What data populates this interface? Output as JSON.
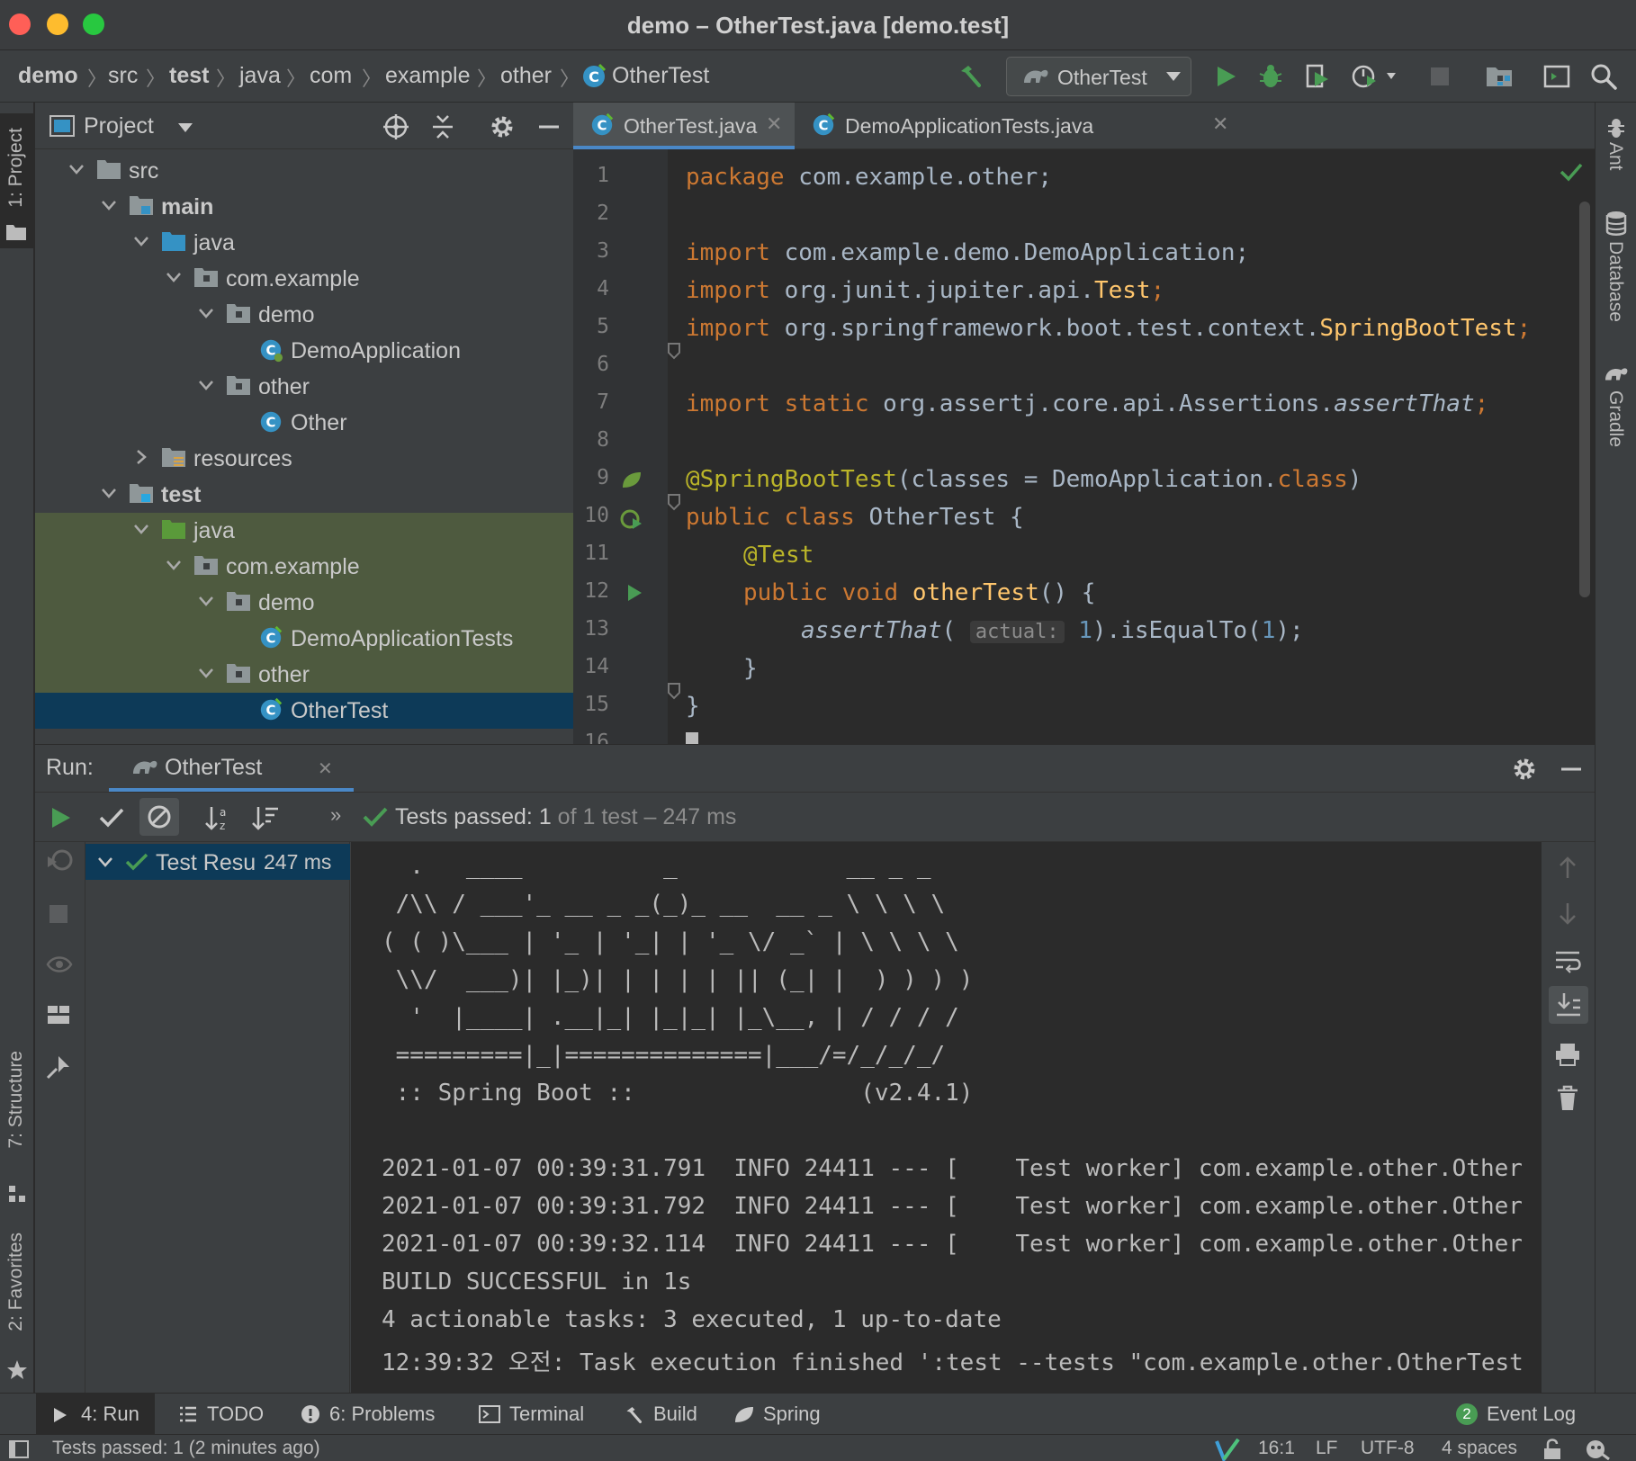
{
  "window": {
    "title": "demo – OtherTest.java [demo.test]"
  },
  "breadcrumbs": [
    "demo",
    "src",
    "test",
    "java",
    "com",
    "example",
    "other",
    "OtherTest"
  ],
  "run_config": {
    "label": "OtherTest"
  },
  "left_strip": {
    "project": "1: Project",
    "structure": "7: Structure",
    "favorites": "2: Favorites"
  },
  "right_strip": {
    "ant": "Ant",
    "database": "Database",
    "gradle": "Gradle"
  },
  "project_panel": {
    "title": "Project",
    "tree": [
      {
        "label": "src",
        "depth": 0,
        "kind": "folder",
        "expanded": true
      },
      {
        "label": "main",
        "depth": 1,
        "kind": "source-root",
        "expanded": true,
        "bold": true
      },
      {
        "label": "java",
        "depth": 2,
        "kind": "java-folder",
        "expanded": true
      },
      {
        "label": "com.example",
        "depth": 3,
        "kind": "package",
        "expanded": true
      },
      {
        "label": "demo",
        "depth": 4,
        "kind": "package",
        "expanded": true
      },
      {
        "label": "DemoApplication",
        "depth": 5,
        "kind": "spring-class"
      },
      {
        "label": "other",
        "depth": 4,
        "kind": "package",
        "expanded": true
      },
      {
        "label": "Other",
        "depth": 5,
        "kind": "class"
      },
      {
        "label": "resources",
        "depth": 2,
        "kind": "resources",
        "expanded": false
      },
      {
        "label": "test",
        "depth": 1,
        "kind": "test-root",
        "expanded": true,
        "bold": true
      },
      {
        "label": "java",
        "depth": 2,
        "kind": "test-folder",
        "expanded": true
      },
      {
        "label": "com.example",
        "depth": 3,
        "kind": "package",
        "expanded": true
      },
      {
        "label": "demo",
        "depth": 4,
        "kind": "package",
        "expanded": true
      },
      {
        "label": "DemoApplicationTests",
        "depth": 5,
        "kind": "test-class"
      },
      {
        "label": "other",
        "depth": 4,
        "kind": "package",
        "expanded": true
      },
      {
        "label": "OtherTest",
        "depth": 5,
        "kind": "test-class",
        "selected": true
      }
    ]
  },
  "editor": {
    "tabs": [
      {
        "label": "OtherTest.java",
        "active": true
      },
      {
        "label": "DemoApplicationTests.java",
        "active": false
      }
    ],
    "line_numbers": [
      "1",
      "2",
      "3",
      "4",
      "5",
      "6",
      "7",
      "8",
      "9",
      "10",
      "11",
      "12",
      "13",
      "14",
      "15",
      "16"
    ],
    "code": {
      "l1": {
        "kw": "package",
        "rest": " com.example.other;"
      },
      "l3": {
        "kw": "import",
        "rest": " com.example.demo.DemoApplication;"
      },
      "l4": {
        "kw": "import",
        "rest": " org.junit.jupiter.api.",
        "cls": "Test",
        ";": ";"
      },
      "l5": {
        "kw": "import",
        "rest": " org.springframework.boot.test.context.",
        "cls": "SpringBootTest"
      },
      "l7": {
        "kw": "import static",
        "rest": " org.assertj.core.api.Assertions.",
        "fn": "assertThat"
      },
      "l9": {
        "ann": "@SpringBootTest",
        "rest": "(classes = DemoApplication.",
        "kw": "class",
        ")": ")"
      },
      "l10": {
        "kw": "public class",
        "rest": " OtherTest {"
      },
      "l11": {
        "ann": "@Test"
      },
      "l12": {
        "kw": "public void",
        "fn": "otherTest",
        "rest": "() {"
      },
      "l13": {
        "fn": "assertThat",
        "hint": "actual:",
        "num1": "1",
        "mid": ").isEqualTo(",
        "num2": "1",
        "end": ");"
      },
      "l14": {
        "rest": "}"
      },
      "l15": {
        "rest": "}"
      }
    }
  },
  "run_panel": {
    "label": "Run:",
    "tab": "OtherTest",
    "status_prefix": "Tests passed:",
    "status_count": "1",
    "status_suffix": "of 1 test – 247 ms",
    "test_tree": {
      "label": "Test Resu",
      "time": "247 ms"
    },
    "console": [
      "  .   ____          _            __ _ _",
      " /\\\\ / ___'_ __ _ _(_)_ __  __ _ \\ \\ \\ \\",
      "( ( )\\___ | '_ | '_| | '_ \\/ _` | \\ \\ \\ \\",
      " \\\\/  ___)| |_)| | | | | || (_| |  ) ) ) )",
      "  '  |____| .__|_| |_|_| |_\\__, | / / / /",
      " =========|_|==============|___/=/_/_/_/",
      " :: Spring Boot ::                (v2.4.1)",
      "",
      "2021-01-07 00:39:31.791  INFO 24411 --- [    Test worker] com.example.other.Other",
      "2021-01-07 00:39:31.792  INFO 24411 --- [    Test worker] com.example.other.Other",
      "2021-01-07 00:39:32.114  INFO 24411 --- [    Test worker] com.example.other.Other",
      "BUILD SUCCESSFUL in 1s",
      "4 actionable tasks: 3 executed, 1 up-to-date",
      "12:39:32 오전: Task execution finished ':test --tests \"com.example.other.OtherTest"
    ]
  },
  "bottom_tabs": {
    "run": "4: Run",
    "todo": "TODO",
    "problems": "6: Problems",
    "terminal": "Terminal",
    "build": "Build",
    "spring": "Spring",
    "event_log_count": "2",
    "event_log": "Event Log"
  },
  "status_bar": {
    "message": "Tests passed: 1 (2 minutes ago)",
    "position": "16:1",
    "line_sep": "LF",
    "encoding": "UTF-8",
    "indent": "4 spaces"
  },
  "colors": {
    "accent": "#4a88c7",
    "success": "#499c54",
    "keyword": "#cc7832",
    "annotation": "#bbb529"
  }
}
